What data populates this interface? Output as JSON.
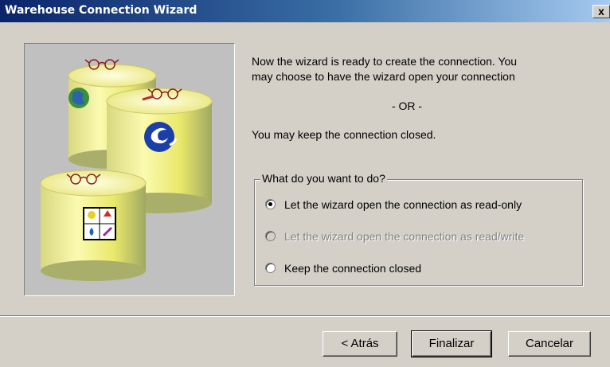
{
  "window": {
    "title": "Warehouse Connection Wizard",
    "close_glyph": "x"
  },
  "message": {
    "line1": "Now the wizard is ready to create the connection.  You",
    "line2": "may choose to have the wizard open your connection",
    "or": "- OR -",
    "line3": "You may keep the connection closed."
  },
  "group": {
    "label": "What do you want to do?",
    "options": [
      {
        "label": "Let the wizard open the connection as read-only",
        "selected": true,
        "enabled": true
      },
      {
        "label": "Let the wizard open the connection as read/write",
        "selected": false,
        "enabled": false
      },
      {
        "label": "Keep the connection closed",
        "selected": false,
        "enabled": true
      }
    ]
  },
  "buttons": {
    "back": "< Atrás",
    "finish": "Finalizar",
    "cancel": "Cancelar"
  },
  "icons": {
    "illustration": "database-cylinders-with-glasses-illustration",
    "close": "close-icon",
    "globe": "globe-icon",
    "logo": "app-logo-icon",
    "tools": "tools-panel-icon"
  },
  "colors": {
    "titlebar_start": "#0a246a",
    "titlebar_end": "#a6caf0",
    "dialog_bg": "#d4d0c8",
    "cylinder_yellow": "#f2f07a"
  }
}
